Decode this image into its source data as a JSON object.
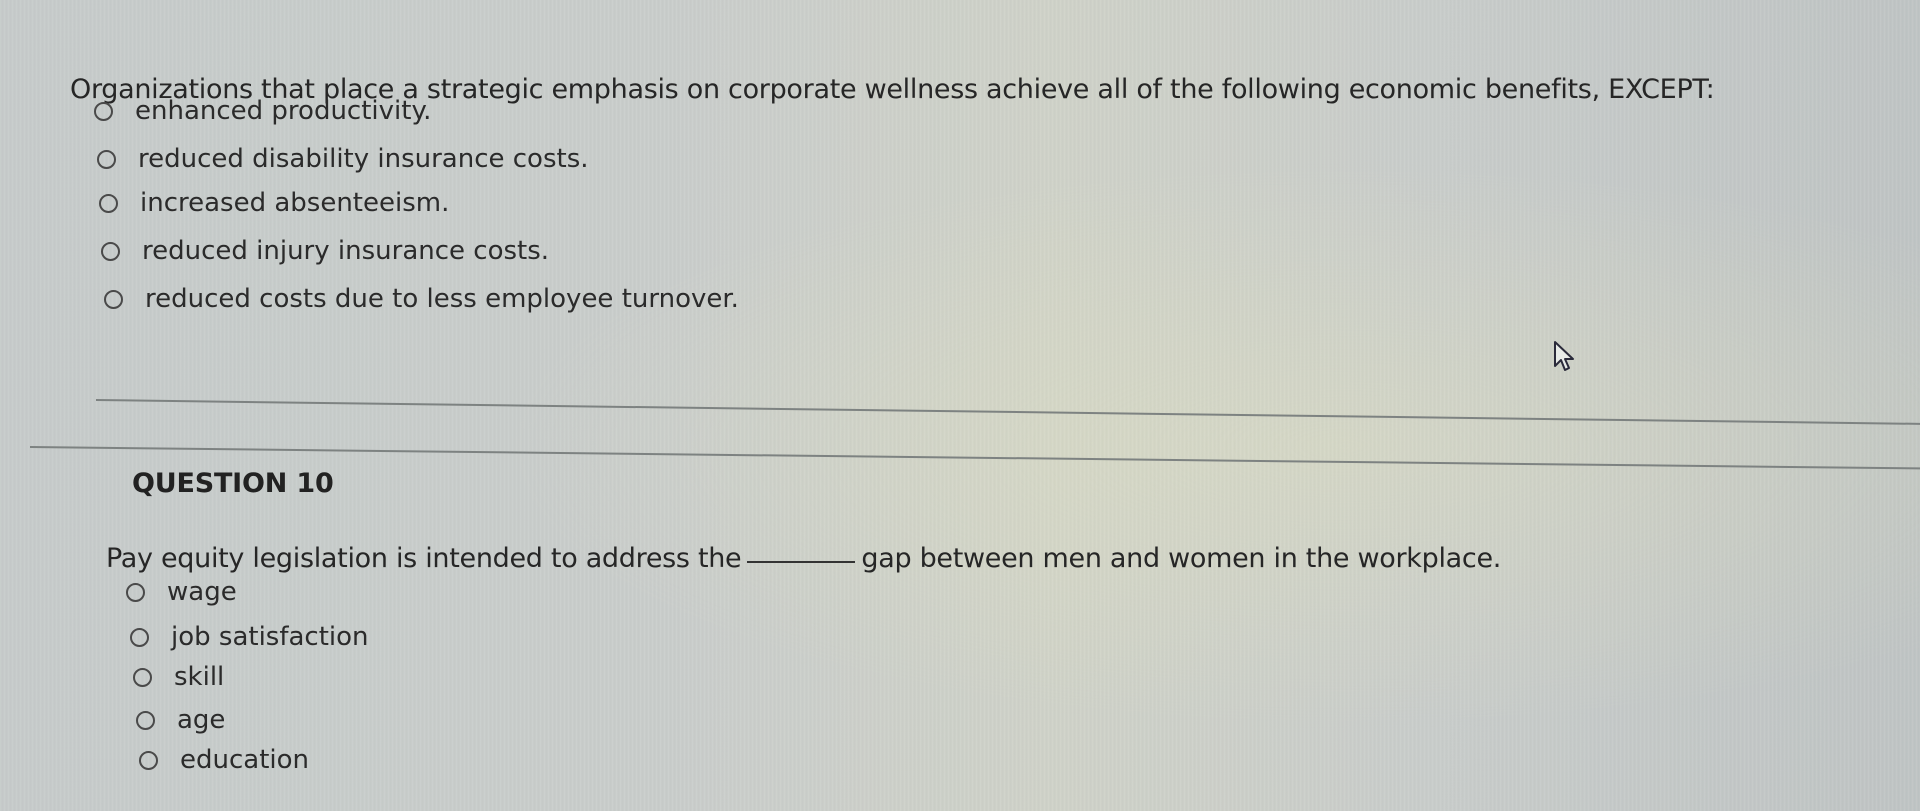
{
  "question9": {
    "prompt": "Organizations that place a strategic emphasis on corporate wellness achieve all of the following economic benefits, EXCEPT:",
    "options": [
      {
        "label": "enhanced productivity.",
        "selected": false
      },
      {
        "label": "reduced disability insurance costs.",
        "selected": false
      },
      {
        "label": "increased absenteeism.",
        "selected": false
      },
      {
        "label": "reduced injury insurance costs.",
        "selected": false
      },
      {
        "label": "reduced costs due to less employee turnover.",
        "selected": false
      }
    ]
  },
  "question10": {
    "heading": "QUESTION 10",
    "prompt_before_blank": "Pay equity legislation is intended to address the",
    "prompt_after_blank": "gap between men and women in the workplace.",
    "options": [
      {
        "label": "wage",
        "selected": false
      },
      {
        "label": "job satisfaction",
        "selected": false
      },
      {
        "label": "skill",
        "selected": false
      },
      {
        "label": "age",
        "selected": false
      },
      {
        "label": "education",
        "selected": false
      }
    ]
  },
  "icons": {
    "radio": "radio-button-unselected",
    "cursor": "mouse-pointer"
  }
}
